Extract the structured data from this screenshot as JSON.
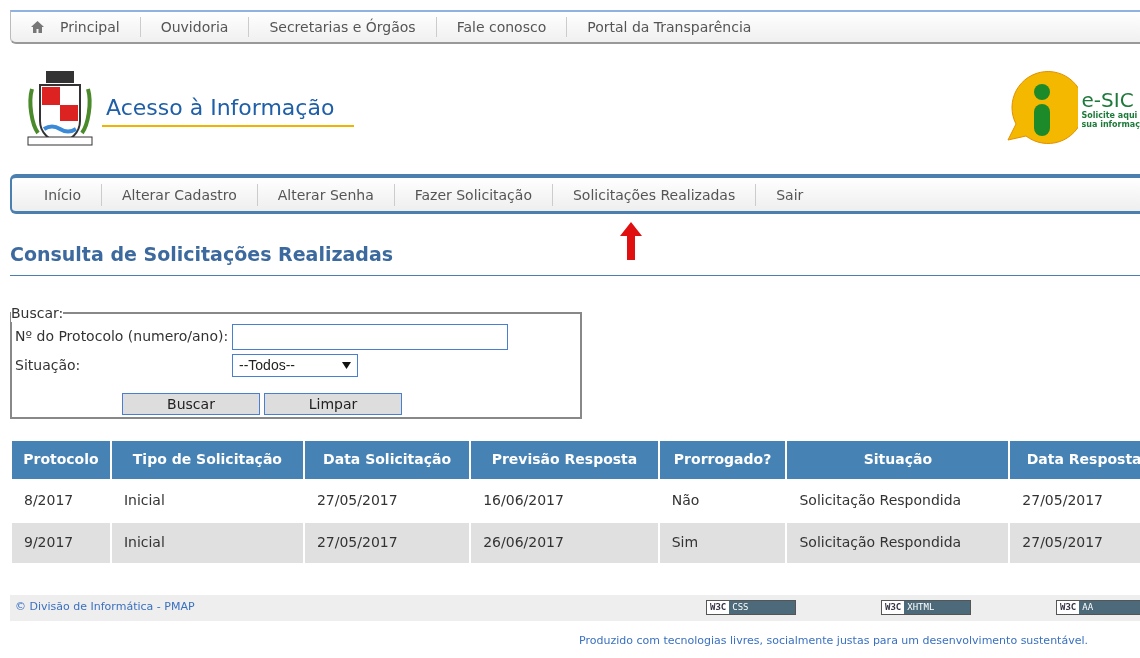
{
  "top_menu": [
    {
      "label": "Principal",
      "kind": "home"
    },
    {
      "label": "Ouvidoria",
      "kind": "link"
    },
    {
      "label": "Secretarias e Órgãos",
      "kind": "link"
    },
    {
      "label": "Fale conosco",
      "kind": "link"
    },
    {
      "label": "Portal da Transparência",
      "kind": "link"
    }
  ],
  "header": {
    "title": "Acesso à Informação",
    "esic": {
      "name": "e-SIC",
      "tagline": [
        "Solicite aqui",
        "sua informaç"
      ]
    }
  },
  "main_menu": [
    "Início",
    "Alterar Cadastro",
    "Alterar Senha",
    "Fazer Solicitação",
    "Solicitações Realizadas",
    "Sair"
  ],
  "page_title": "Consulta de Solicitações Realizadas",
  "search": {
    "legend": "Buscar:",
    "protocol_label": "Nº do Protocolo (numero/ano):",
    "status_label": "Situação:",
    "status_value": "--Todos--",
    "buttons": [
      "Buscar",
      "Limpar"
    ]
  },
  "table": {
    "columns": [
      "Protocolo",
      "Tipo de Solicitação",
      "Data Solicitação",
      "Previsão Resposta",
      "Prorrogado?",
      "Situação",
      "Data Resposta"
    ],
    "rows": [
      [
        "8/2017",
        "Inicial",
        "27/05/2017",
        "16/06/2017",
        "Não",
        "Solicitação Respondida",
        "27/05/2017"
      ],
      [
        "9/2017",
        "Inicial",
        "27/05/2017",
        "26/06/2017",
        "Sim",
        "Solicitação Respondida",
        "27/05/2017"
      ]
    ]
  },
  "footer": {
    "credit": "© Divisão de Informática - PMAP",
    "badges": [
      {
        "left": "W3C",
        "right": "CSS"
      },
      {
        "left": "W3C",
        "right": "XHTML"
      },
      {
        "left": "W3C",
        "right": "AA"
      }
    ],
    "note": "Produzido com tecnologias livres, socialmente justas para um desenvolvimento sustentável."
  }
}
